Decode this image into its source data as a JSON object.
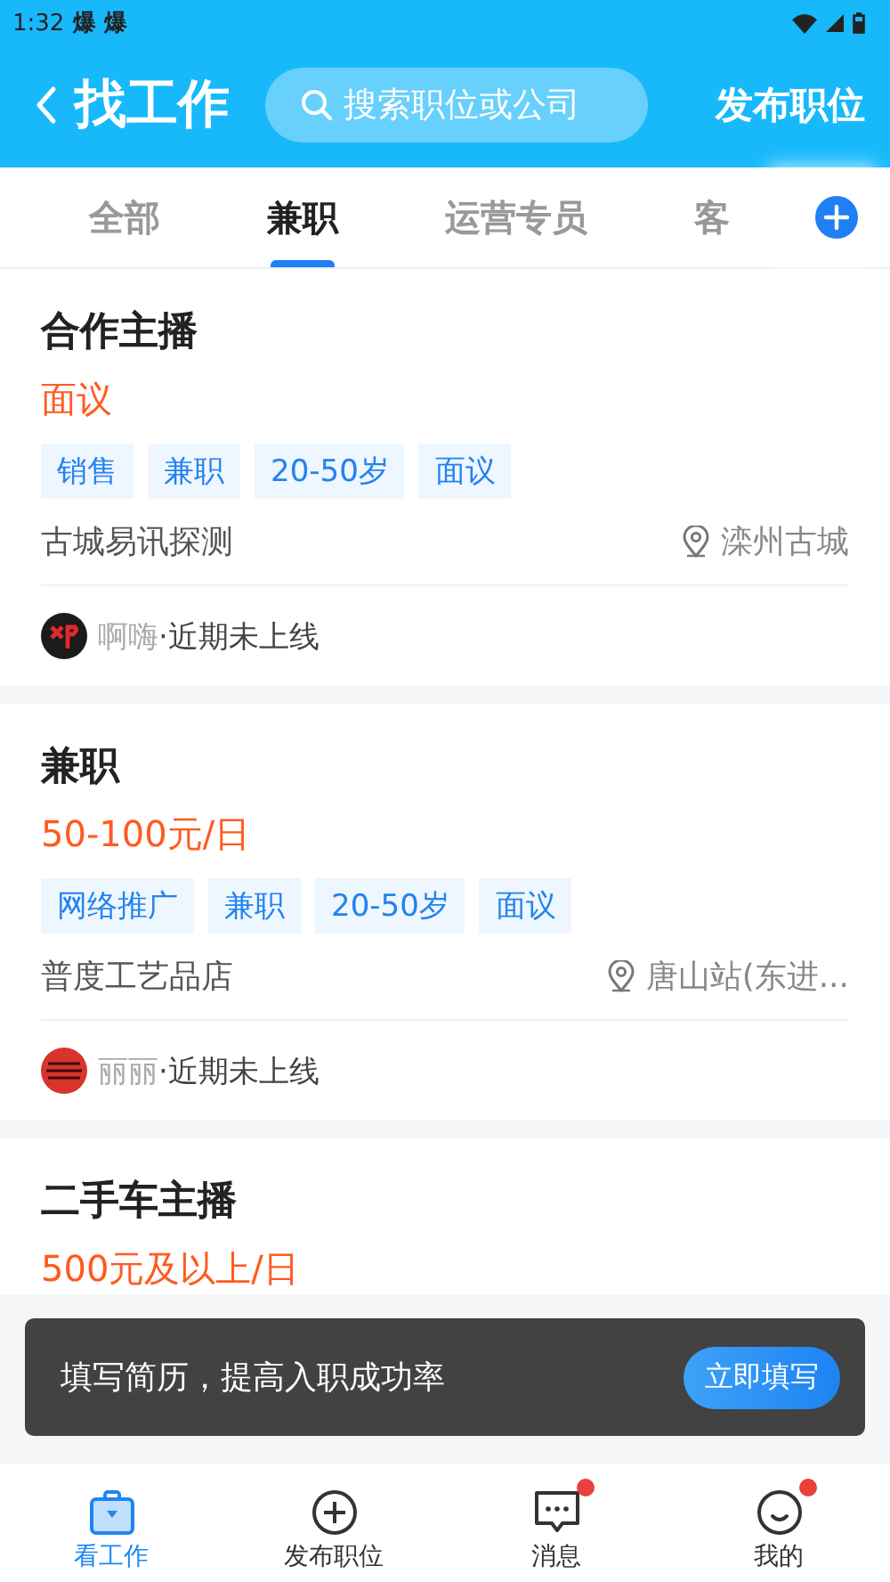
{
  "status_bar": {
    "time": "1:32",
    "notifications": "爆 爆"
  },
  "header": {
    "title": "找工作",
    "search": {
      "placeholder": "搜索职位或公司"
    },
    "action": "发布职位"
  },
  "tabs": [
    {
      "label": "全部",
      "selected": false
    },
    {
      "label": "兼职",
      "selected": true
    },
    {
      "label": "运营专员",
      "selected": false
    },
    {
      "label": "客",
      "selected": false
    }
  ],
  "jobs": [
    {
      "title": "合作主播",
      "salary": "面议",
      "tags": [
        "销售",
        "兼职",
        "20-50岁",
        "面议"
      ],
      "company": "古城易讯探测",
      "location": "滦州古城",
      "recruiter": "啊嗨",
      "status": "·近期未上线",
      "avatar": {
        "kind": "dark"
      }
    },
    {
      "title": "兼职",
      "salary": "50-100元/日",
      "tags": [
        "网络推广",
        "兼职",
        "20-50岁",
        "面议"
      ],
      "company": "普度工艺品店",
      "location": "唐山站(东进...",
      "recruiter": "丽丽",
      "status": "·近期未上线",
      "avatar": {
        "kind": "red"
      }
    },
    {
      "title": "二手车主播",
      "salary": "500元及以上/日"
    }
  ],
  "toast": {
    "text": "填写简历，提高入职成功率",
    "button": "立即填写"
  },
  "bottom_nav": [
    {
      "label": "看工作",
      "kind": "briefcase",
      "selected": true,
      "badge": false
    },
    {
      "label": "发布职位",
      "kind": "plus",
      "selected": false,
      "badge": false
    },
    {
      "label": "消息",
      "kind": "chat",
      "selected": false,
      "badge": true
    },
    {
      "label": "我的",
      "kind": "face",
      "selected": false,
      "badge": true
    }
  ]
}
